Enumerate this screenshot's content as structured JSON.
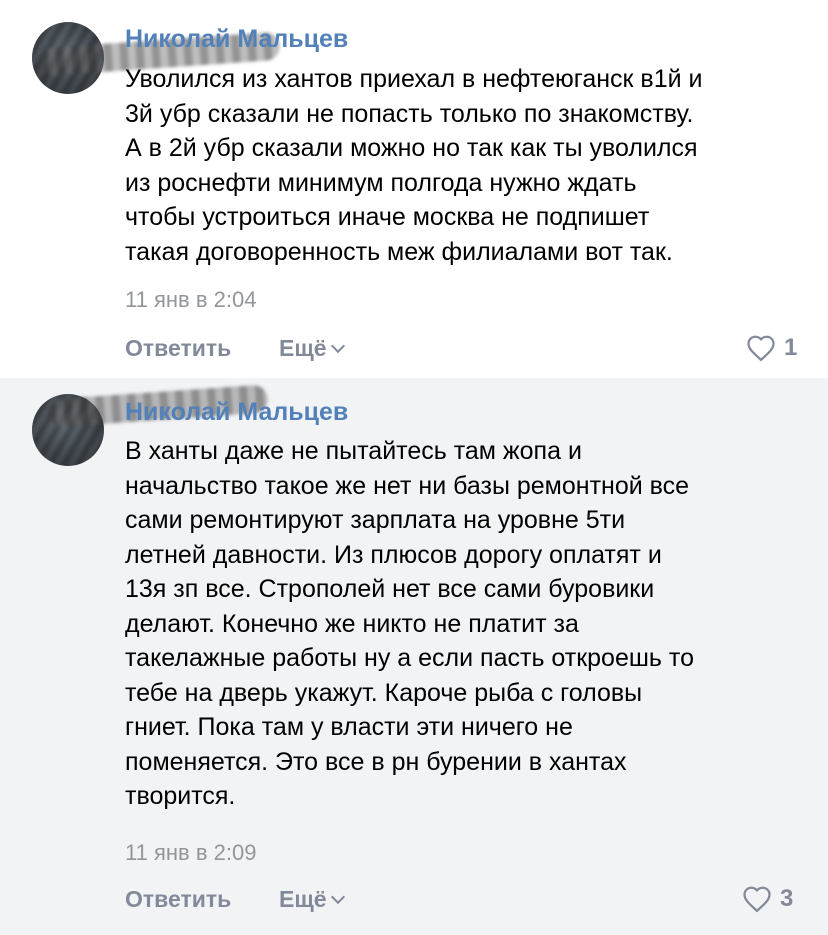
{
  "comments": [
    {
      "author": "Николай Мальцев",
      "lines": [
        "Уволился из хантов приехал в нефтеюганск в1й и",
        "3й убр сказали не попасть только по знакомству.",
        "А в 2й убр сказали можно но так как ты уволился",
        "из роснефти минимум полгода нужно ждать",
        "чтобы устроиться иначе москва не подпишет",
        "такая договоренность меж филиалами вот так."
      ],
      "time": "11 янв в 2:04",
      "reply_label": "Ответить",
      "more_label": "Ещё",
      "likes": "1"
    },
    {
      "author": "Николай Мальцев",
      "lines": [
        "В ханты даже не пытайтесь там жопа и",
        "начальство такое же нет ни базы ремонтной все",
        "сами ремонтируют зарплата на уровне 5ти",
        "летней давности. Из плюсов дорогу оплатят и",
        "13я зп все. Строполей нет все сами буровики",
        "делают. Конечно же никто не платит за",
        "такелажные работы ну а если пасть откроешь то",
        "тебе на дверь укажут. Кароче рыба с головы",
        "гниет. Пока там у власти эти ничего не",
        "поменяется. Это все в рн бурении в хантах",
        "творится."
      ],
      "time": "11 янв в 2:09",
      "reply_label": "Ответить",
      "more_label": "Ещё",
      "likes": "3"
    }
  ],
  "icons": {
    "like": "heart-outline-icon",
    "more": "chevron-down-icon"
  },
  "colors": {
    "author": "#5181b8",
    "meta": "#939699",
    "action": "#828a99",
    "alt_bg": "#f2f3f5"
  }
}
